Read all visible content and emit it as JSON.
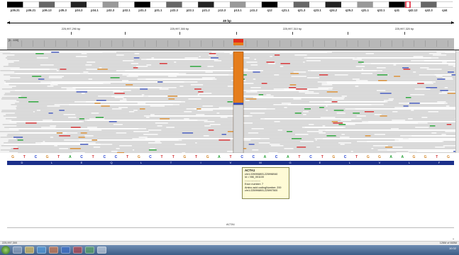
{
  "ideogram": {
    "bands": [
      "p36.31",
      "p36.21",
      "p36.13",
      "p35.3",
      "p34.3",
      "p34.1",
      "p32.3",
      "p32.1",
      "p31.3",
      "p31.1",
      "p22.3",
      "p22.1",
      "p21.2",
      "p13.3",
      "p13.1",
      "p11.2",
      "q12",
      "q21.1",
      "q21.3",
      "q23.1",
      "q24.2",
      "q25.2",
      "q31.1",
      "q32.1",
      "q41",
      "q42.12",
      "q42.3",
      "q44"
    ],
    "selected_band": "q42.12",
    "accent": "#e0142a"
  },
  "ruler": {
    "width_label": "40 bp",
    "tick_labels": [
      "225,997,290 bp",
      "225,997,300 bp",
      "225,997,310 bp",
      "225,997,320 bp"
    ]
  },
  "coverage": {
    "range_label": "[0 - 100]",
    "colors": {
      "track": "#b8b8b8",
      "variant_red": "#e42d1e",
      "variant_orange": "#e57d1c"
    }
  },
  "reads": {
    "background": "#f2f2f2",
    "read_color": "#cfcfcf",
    "highlight_color": "#e57d1c",
    "deletion_color": "#3b51b8"
  },
  "sequence": {
    "bases": [
      "G",
      "T",
      "C",
      "G",
      "T",
      "A",
      "C",
      "T",
      "C",
      "C",
      "T",
      "G",
      "C",
      "T",
      "T",
      "G",
      "T",
      "G",
      "A",
      "T",
      "C",
      "C",
      "A",
      "C",
      "A",
      "T",
      "C",
      "T",
      "G",
      "C",
      "T",
      "G",
      "G",
      "A",
      "A",
      "G",
      "G",
      "T",
      "G"
    ],
    "colors": {
      "A": "#1f9d2e",
      "C": "#2140d1",
      "G": "#d4872a",
      "T": "#d0272a"
    }
  },
  "amino_acids": [
    "D",
    "L",
    "E",
    "Q",
    "L",
    "T",
    "I",
    "V",
    "M",
    "G",
    "E",
    "L",
    "V",
    "L",
    "F"
  ],
  "tooltip": {
    "title": "ACTA1",
    "lines": [
      "chr1:225996893-225998940",
      "id = NM_001100",
      "------------------",
      "Exon number: 7",
      "Amino acid codingNumber: 200",
      "chr1:225996893-225997500"
    ]
  },
  "gene_track": {
    "name": "ACTA1"
  },
  "status": {
    "left": "225,997,300",
    "right": "126M of 665M"
  },
  "taskbar": {
    "apps": [
      "explorer",
      "ie",
      "media",
      "word",
      "paint",
      "terminal",
      "igv"
    ],
    "clock": "10:32"
  }
}
